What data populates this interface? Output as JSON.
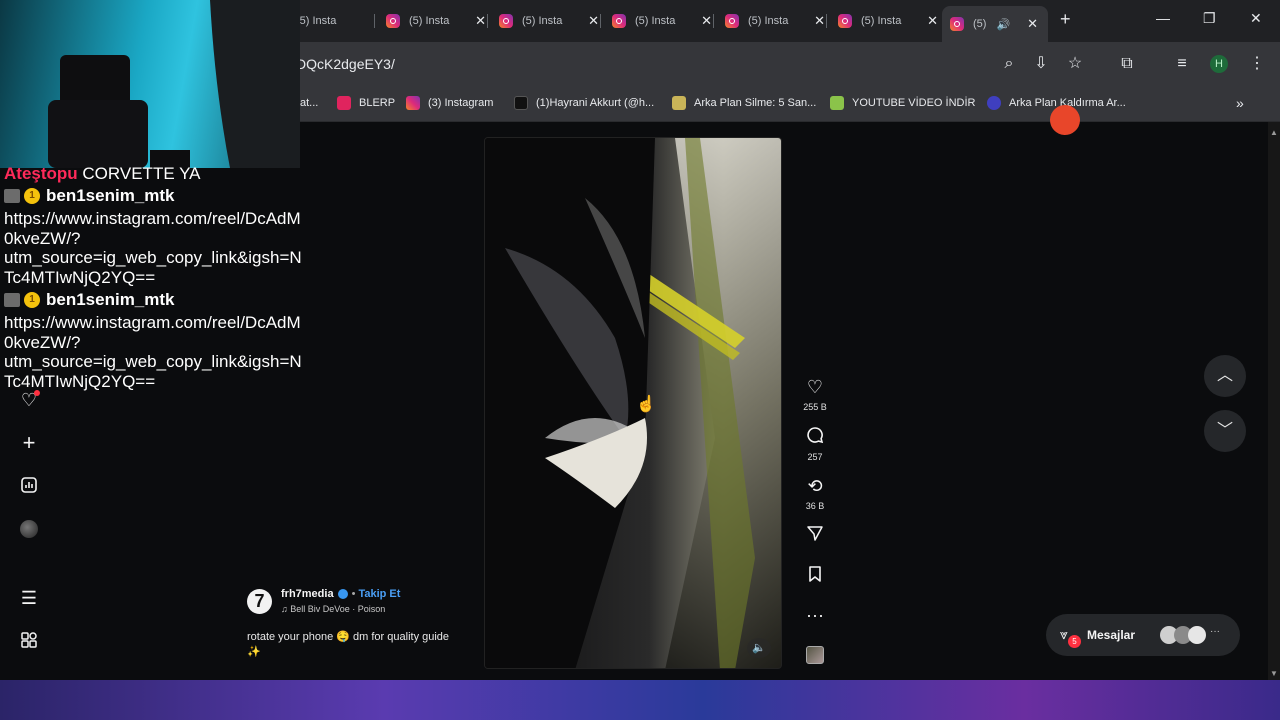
{
  "browser": {
    "tabs": [
      {
        "title": "(5) Insta"
      },
      {
        "title": "(5) Insta"
      },
      {
        "title": "(5) Insta"
      },
      {
        "title": "(5) Insta"
      },
      {
        "title": "(5) Insta"
      },
      {
        "title": "(5) Insta"
      },
      {
        "title": "(5)"
      }
    ],
    "new_tab": "+",
    "url": "DQcK2dgeEY3/",
    "profile_initial": "H",
    "bookmarks": [
      {
        "label": "at...",
        "color": "#7c7c7c"
      },
      {
        "label": "BLERP",
        "color": "#e0245e"
      },
      {
        "label": "(3) Instagram",
        "color": "#dd2a7b"
      },
      {
        "label": "(1)Hayrani Akkurt (@h...",
        "color": "#111111"
      },
      {
        "label": "Arka Plan Silme: 5 San...",
        "color": "#c9b458"
      },
      {
        "label": "YOUTUBE VİDEO İNDİR",
        "color": "#8bc34a"
      },
      {
        "label": "Arka Plan Kaldırma Ar...",
        "color": "#3f3fbf"
      }
    ]
  },
  "reel": {
    "actions": {
      "likes": "255 B",
      "comments": "257",
      "reposts": "36 B"
    },
    "author": {
      "username": "frh7media",
      "avatar_char": "7",
      "separator": "•",
      "follow": "Takip Et",
      "audio": "Bell Biv DeVoe · Poison"
    },
    "caption_line1": "rotate your phone 🤤 dm for quality guide",
    "caption_line2": "✨"
  },
  "messages": {
    "label": "Mesajlar",
    "badge": "5"
  },
  "chat": {
    "top_name": "Ateştopu",
    "top_text": "CORVETTE YA",
    "badge_num": "1",
    "messages": [
      {
        "user": "ben1senim_mtk",
        "lines": [
          "https://www.instagram.com/reel/DcAdM",
          "0kveZW/?",
          "utm_source=ig_web_copy_link&igsh=N",
          "Tc4MTIwNjQ2YQ=="
        ]
      },
      {
        "user": "ben1senim_mtk",
        "lines": [
          "https://www.instagram.com/reel/DcAdM",
          "0kveZW/?",
          "utm_source=ig_web_copy_link&igsh=N",
          "Tc4MTIwNjQ2YQ=="
        ]
      }
    ]
  }
}
